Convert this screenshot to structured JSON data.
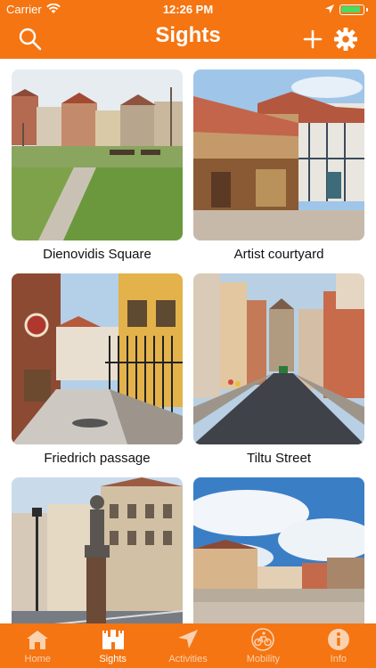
{
  "status_bar": {
    "carrier": "Carrier",
    "time": "12:26 PM"
  },
  "header": {
    "title": "Sights",
    "accent_color": "#f57512"
  },
  "sights": [
    {
      "name": "Dienovidis Square"
    },
    {
      "name": "Artist courtyard"
    },
    {
      "name": "Friedrich passage"
    },
    {
      "name": "Tiltu Street"
    },
    {
      "name": ""
    },
    {
      "name": ""
    }
  ],
  "tabbar": {
    "items": [
      {
        "label": "Home",
        "icon": "home-icon",
        "active": false
      },
      {
        "label": "Sights",
        "icon": "castle-icon",
        "active": true
      },
      {
        "label": "Activities",
        "icon": "navigation-arrow-icon",
        "active": false
      },
      {
        "label": "Mobility",
        "icon": "bicycle-icon",
        "active": false
      },
      {
        "label": "Info",
        "icon": "info-icon",
        "active": false
      }
    ]
  }
}
